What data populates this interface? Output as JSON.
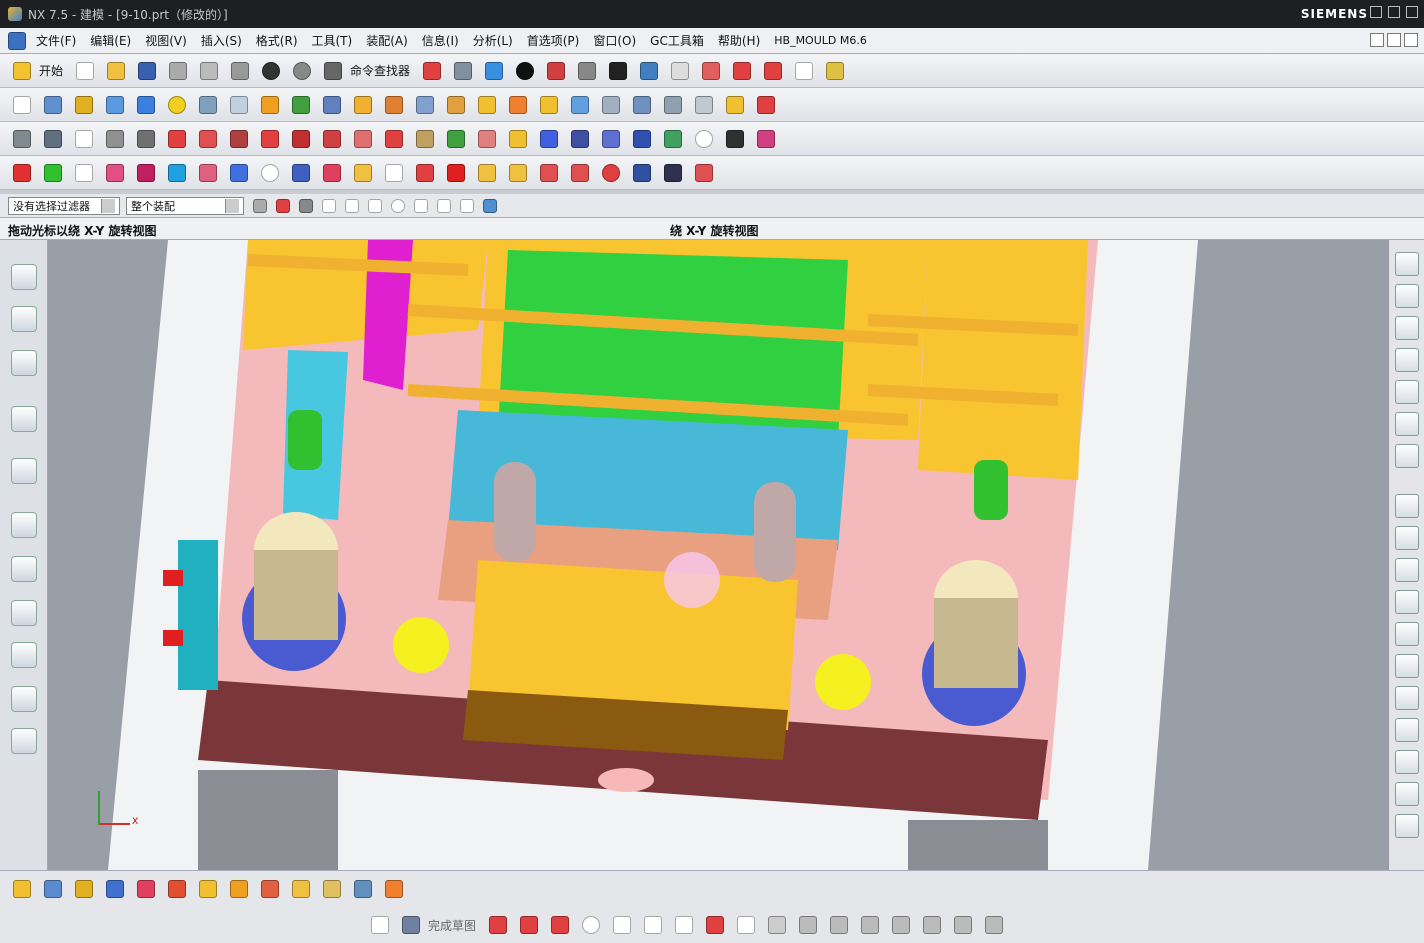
{
  "window": {
    "title": "NX 7.5 - 建模 - [9-10.prt（修改的）]",
    "brand": "SIEMENS"
  },
  "menu": {
    "items": [
      "文件(F)",
      "编辑(E)",
      "视图(V)",
      "插入(S)",
      "格式(R)",
      "工具(T)",
      "装配(A)",
      "信息(I)",
      "分析(L)",
      "首选项(P)",
      "窗口(O)",
      "GC工具箱",
      "帮助(H)",
      "HB_MOULD M6.6"
    ]
  },
  "toolbar": {
    "start_label": "开始",
    "finder_label": "命令查找器"
  },
  "selection": {
    "filter_value": "没有选择过滤器",
    "scope_value": "整个装配"
  },
  "cue": {
    "text": "拖动光标以绕 X-Y 旋转视图",
    "status": "绕 X-Y 旋转视图"
  },
  "sketch": {
    "finish_label": "完成草图"
  },
  "triad": {
    "x_label": "X"
  },
  "colors": {
    "plate_pink": "#f4b9bb",
    "plate_orange": "#f8c430",
    "cavity_green": "#30d040",
    "insert_blue": "#48b8d8",
    "clamp_maroon": "#7a3638",
    "guide_cream": "#f3e7bd",
    "ejector_magenta": "#e020d0",
    "viewport_bg": "#9a9ea6"
  }
}
